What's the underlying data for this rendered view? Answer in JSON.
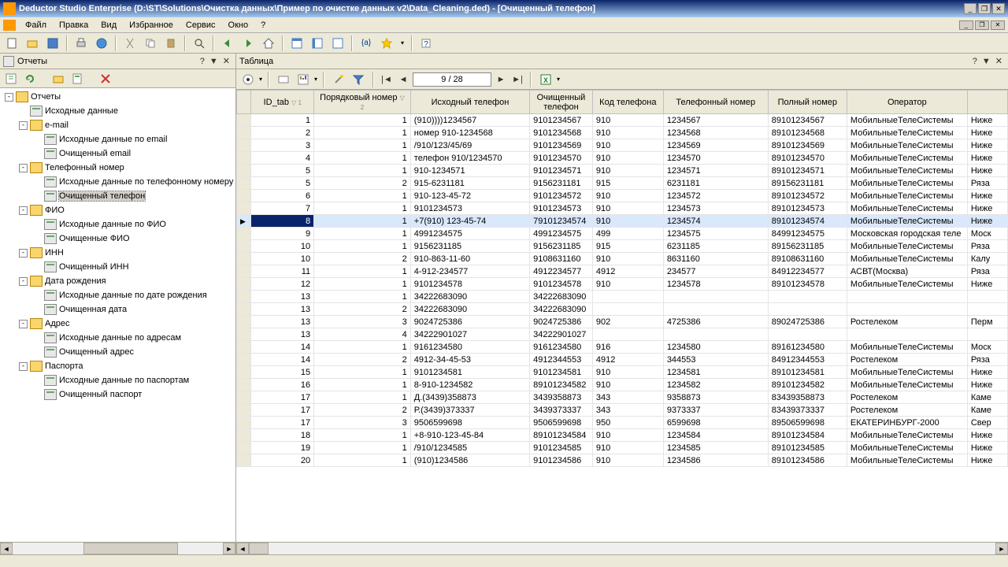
{
  "window": {
    "title": "Deductor Studio Enterprise (D:\\ST\\Solutions\\Очистка данных\\Пример по очистке данных v2\\Data_Cleaning.ded) - [Очищенный телефон]"
  },
  "menu": {
    "file": "Файл",
    "edit": "Правка",
    "view": "Вид",
    "favorites": "Избранное",
    "service": "Сервис",
    "window": "Окно",
    "help": "?"
  },
  "leftPane": {
    "title": "Отчеты",
    "help": "?",
    "dropdown": "▼",
    "close": "✕"
  },
  "rightPane": {
    "title": "Таблица",
    "help": "?",
    "dropdown": "▼",
    "close": "✕"
  },
  "pager": {
    "label": "9 / 28"
  },
  "tree": [
    {
      "level": 0,
      "exp": "-",
      "ico": "folder",
      "label": "Отчеты"
    },
    {
      "level": 1,
      "exp": "",
      "ico": "report",
      "label": "Исходные данные"
    },
    {
      "level": 1,
      "exp": "-",
      "ico": "folder",
      "label": "e-mail"
    },
    {
      "level": 2,
      "exp": "",
      "ico": "report",
      "label": "Исходные данные по email"
    },
    {
      "level": 2,
      "exp": "",
      "ico": "report",
      "label": "Очищенный email"
    },
    {
      "level": 1,
      "exp": "-",
      "ico": "folder",
      "label": "Телефонный номер"
    },
    {
      "level": 2,
      "exp": "",
      "ico": "report",
      "label": "Исходные данные по телефонному номеру"
    },
    {
      "level": 2,
      "exp": "",
      "ico": "report",
      "label": "Очищенный телефон",
      "sel": true
    },
    {
      "level": 1,
      "exp": "-",
      "ico": "folder",
      "label": "ФИО"
    },
    {
      "level": 2,
      "exp": "",
      "ico": "report",
      "label": "Исходные данные по ФИО"
    },
    {
      "level": 2,
      "exp": "",
      "ico": "report",
      "label": "Очищенные ФИО"
    },
    {
      "level": 1,
      "exp": "-",
      "ico": "folder",
      "label": "ИНН"
    },
    {
      "level": 2,
      "exp": "",
      "ico": "report",
      "label": "Очищенный ИНН"
    },
    {
      "level": 1,
      "exp": "-",
      "ico": "folder",
      "label": "Дата рождения"
    },
    {
      "level": 2,
      "exp": "",
      "ico": "report",
      "label": "Исходные данные по дате рождения"
    },
    {
      "level": 2,
      "exp": "",
      "ico": "report",
      "label": "Очищенная дата"
    },
    {
      "level": 1,
      "exp": "-",
      "ico": "folder",
      "label": "Адрес"
    },
    {
      "level": 2,
      "exp": "",
      "ico": "report",
      "label": "Исходные данные по адресам"
    },
    {
      "level": 2,
      "exp": "",
      "ico": "report",
      "label": "Очищенный адрес"
    },
    {
      "level": 1,
      "exp": "-",
      "ico": "folder",
      "label": "Паспорта"
    },
    {
      "level": 2,
      "exp": "",
      "ico": "report",
      "label": "Исходные данные по паспортам"
    },
    {
      "level": 2,
      "exp": "",
      "ico": "report",
      "label": "Очищенный паспорт"
    }
  ],
  "columns": {
    "id": "ID_tab",
    "ord": "Порядковый номер",
    "src": "Исходный телефон",
    "clean": "Очищенный телефон",
    "code": "Код телефона",
    "tel": "Телефонный номер",
    "full": "Полный номер",
    "op": "Оператор"
  },
  "rows": [
    {
      "id": 1,
      "ord": 1,
      "src": "(910))))1234567",
      "clean": "9101234567",
      "code": "910",
      "tel": "1234567",
      "full": "89101234567",
      "op": "МобильныеТелеСистемы",
      "ext": "Ниже"
    },
    {
      "id": 2,
      "ord": 1,
      "src": "номер 910-1234568",
      "clean": "9101234568",
      "code": "910",
      "tel": "1234568",
      "full": "89101234568",
      "op": "МобильныеТелеСистемы",
      "ext": "Ниже"
    },
    {
      "id": 3,
      "ord": 1,
      "src": "/910/123/45/69",
      "clean": "9101234569",
      "code": "910",
      "tel": "1234569",
      "full": "89101234569",
      "op": "МобильныеТелеСистемы",
      "ext": "Ниже"
    },
    {
      "id": 4,
      "ord": 1,
      "src": "телефон 910/1234570",
      "clean": "9101234570",
      "code": "910",
      "tel": "1234570",
      "full": "89101234570",
      "op": "МобильныеТелеСистемы",
      "ext": "Ниже"
    },
    {
      "id": 5,
      "ord": 1,
      "src": "910-1234571",
      "clean": "9101234571",
      "code": "910",
      "tel": "1234571",
      "full": "89101234571",
      "op": "МобильныеТелеСистемы",
      "ext": "Ниже"
    },
    {
      "id": 5,
      "ord": 2,
      "src": "915-6231181",
      "clean": "9156231181",
      "code": "915",
      "tel": "6231181",
      "full": "89156231181",
      "op": "МобильныеТелеСистемы",
      "ext": "Ряза"
    },
    {
      "id": 6,
      "ord": 1,
      "src": "910-123-45-72",
      "clean": "9101234572",
      "code": "910",
      "tel": "1234572",
      "full": "89101234572",
      "op": "МобильныеТелеСистемы",
      "ext": "Ниже"
    },
    {
      "id": 7,
      "ord": 1,
      "src": "9101234573",
      "clean": "9101234573",
      "code": "910",
      "tel": "1234573",
      "full": "89101234573",
      "op": "МобильныеТелеСистемы",
      "ext": "Ниже"
    },
    {
      "id": 8,
      "ord": 1,
      "src": "+7(910) 123-45-74",
      "clean": "79101234574",
      "code": "910",
      "tel": "1234574",
      "full": "89101234574",
      "op": "МобильныеТелеСистемы",
      "ext": "Ниже",
      "sel": true
    },
    {
      "id": 9,
      "ord": 1,
      "src": "4991234575",
      "clean": "4991234575",
      "code": "499",
      "tel": "1234575",
      "full": "84991234575",
      "op": "Московская городская теле",
      "ext": "Моск"
    },
    {
      "id": 10,
      "ord": 1,
      "src": "9156231185",
      "clean": "9156231185",
      "code": "915",
      "tel": "6231185",
      "full": "89156231185",
      "op": "МобильныеТелеСистемы",
      "ext": "Ряза"
    },
    {
      "id": 10,
      "ord": 2,
      "src": "910-863-11-60",
      "clean": "9108631160",
      "code": "910",
      "tel": "8631160",
      "full": "89108631160",
      "op": "МобильныеТелеСистемы",
      "ext": "Калу"
    },
    {
      "id": 11,
      "ord": 1,
      "src": "4-912-234577",
      "clean": "4912234577",
      "code": "4912",
      "tel": "234577",
      "full": "84912234577",
      "op": "АСВТ(Москва)",
      "ext": "Ряза"
    },
    {
      "id": 12,
      "ord": 1,
      "src": "9101234578",
      "clean": "9101234578",
      "code": "910",
      "tel": "1234578",
      "full": "89101234578",
      "op": "МобильныеТелеСистемы",
      "ext": "Ниже"
    },
    {
      "id": 13,
      "ord": 1,
      "src": "34222683090",
      "clean": "34222683090",
      "code": "",
      "tel": "",
      "full": "",
      "op": "",
      "ext": ""
    },
    {
      "id": 13,
      "ord": 2,
      "src": "34222683090",
      "clean": "34222683090",
      "code": "",
      "tel": "",
      "full": "",
      "op": "",
      "ext": ""
    },
    {
      "id": 13,
      "ord": 3,
      "src": "9024725386",
      "clean": "9024725386",
      "code": "902",
      "tel": "4725386",
      "full": "89024725386",
      "op": "Ростелеком",
      "ext": "Перм"
    },
    {
      "id": 13,
      "ord": 4,
      "src": "34222901027",
      "clean": "34222901027",
      "code": "",
      "tel": "",
      "full": "",
      "op": "",
      "ext": ""
    },
    {
      "id": 14,
      "ord": 1,
      "src": "9161234580",
      "clean": "9161234580",
      "code": "916",
      "tel": "1234580",
      "full": "89161234580",
      "op": "МобильныеТелеСистемы",
      "ext": "Моск"
    },
    {
      "id": 14,
      "ord": 2,
      "src": "4912-34-45-53",
      "clean": "4912344553",
      "code": "4912",
      "tel": "344553",
      "full": "84912344553",
      "op": "Ростелеком",
      "ext": "Ряза"
    },
    {
      "id": 15,
      "ord": 1,
      "src": "9101234581",
      "clean": "9101234581",
      "code": "910",
      "tel": "1234581",
      "full": "89101234581",
      "op": "МобильныеТелеСистемы",
      "ext": "Ниже"
    },
    {
      "id": 16,
      "ord": 1,
      "src": "8-910-1234582",
      "clean": "89101234582",
      "code": "910",
      "tel": "1234582",
      "full": "89101234582",
      "op": "МобильныеТелеСистемы",
      "ext": "Ниже"
    },
    {
      "id": 17,
      "ord": 1,
      "src": "Д.(3439)358873",
      "clean": "3439358873",
      "code": "343",
      "tel": "9358873",
      "full": "83439358873",
      "op": "Ростелеком",
      "ext": "Каме"
    },
    {
      "id": 17,
      "ord": 2,
      "src": "Р.(3439)373337",
      "clean": "3439373337",
      "code": "343",
      "tel": "9373337",
      "full": "83439373337",
      "op": "Ростелеком",
      "ext": "Каме"
    },
    {
      "id": 17,
      "ord": 3,
      "src": "9506599698",
      "clean": "9506599698",
      "code": "950",
      "tel": "6599698",
      "full": "89506599698",
      "op": "ЕКАТЕРИНБУРГ-2000",
      "ext": "Свер"
    },
    {
      "id": 18,
      "ord": 1,
      "src": "+8-910-123-45-84",
      "clean": "89101234584",
      "code": "910",
      "tel": "1234584",
      "full": "89101234584",
      "op": "МобильныеТелеСистемы",
      "ext": "Ниже"
    },
    {
      "id": 19,
      "ord": 1,
      "src": "/910/1234585",
      "clean": "9101234585",
      "code": "910",
      "tel": "1234585",
      "full": "89101234585",
      "op": "МобильныеТелеСистемы",
      "ext": "Ниже"
    },
    {
      "id": 20,
      "ord": 1,
      "src": "(910)1234586",
      "clean": "9101234586",
      "code": "910",
      "tel": "1234586",
      "full": "89101234586",
      "op": "МобильныеТелеСистемы",
      "ext": "Ниже"
    }
  ]
}
